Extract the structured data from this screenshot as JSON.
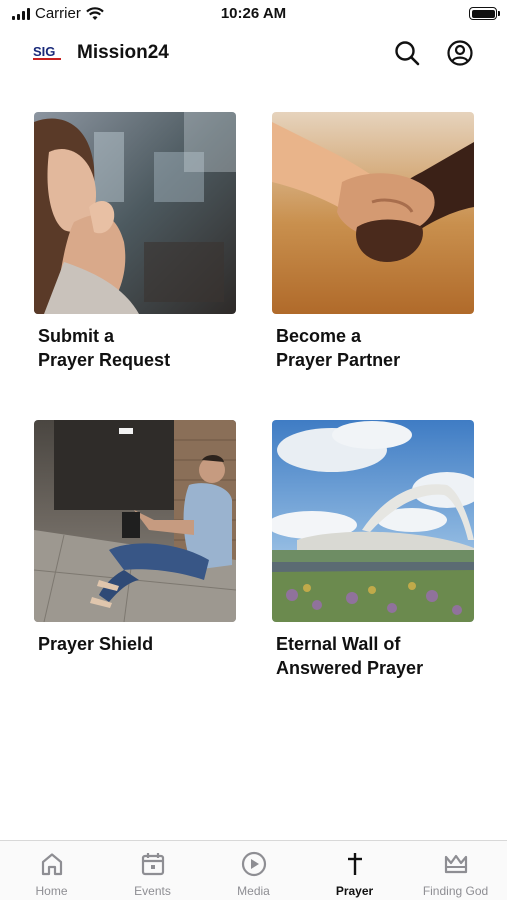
{
  "status_bar": {
    "carrier": "Carrier",
    "time": "10:26 AM"
  },
  "header": {
    "title": "Mission24",
    "logo_text": "SIG"
  },
  "cards": [
    {
      "title": "Submit a\nPrayer Request",
      "image": "woman-praying-photo"
    },
    {
      "title": "Become a\nPrayer Partner",
      "image": "holding-hands-photo"
    },
    {
      "title": "Prayer Shield",
      "image": "man-reading-bible-photo"
    },
    {
      "title": "Eternal Wall of\nAnswered Prayer",
      "image": "eternal-wall-arch-photo"
    }
  ],
  "tabs": [
    {
      "label": "Home",
      "icon": "home-icon",
      "active": false
    },
    {
      "label": "Events",
      "icon": "calendar-icon",
      "active": false
    },
    {
      "label": "Media",
      "icon": "play-circle-icon",
      "active": false
    },
    {
      "label": "Prayer",
      "icon": "cross-icon",
      "active": true
    },
    {
      "label": "Finding God",
      "icon": "crown-icon",
      "active": false
    }
  ],
  "colors": {
    "active_tab": "#111111",
    "inactive_tab": "#8e8e93",
    "tab_bar_bg": "#fafafa"
  }
}
